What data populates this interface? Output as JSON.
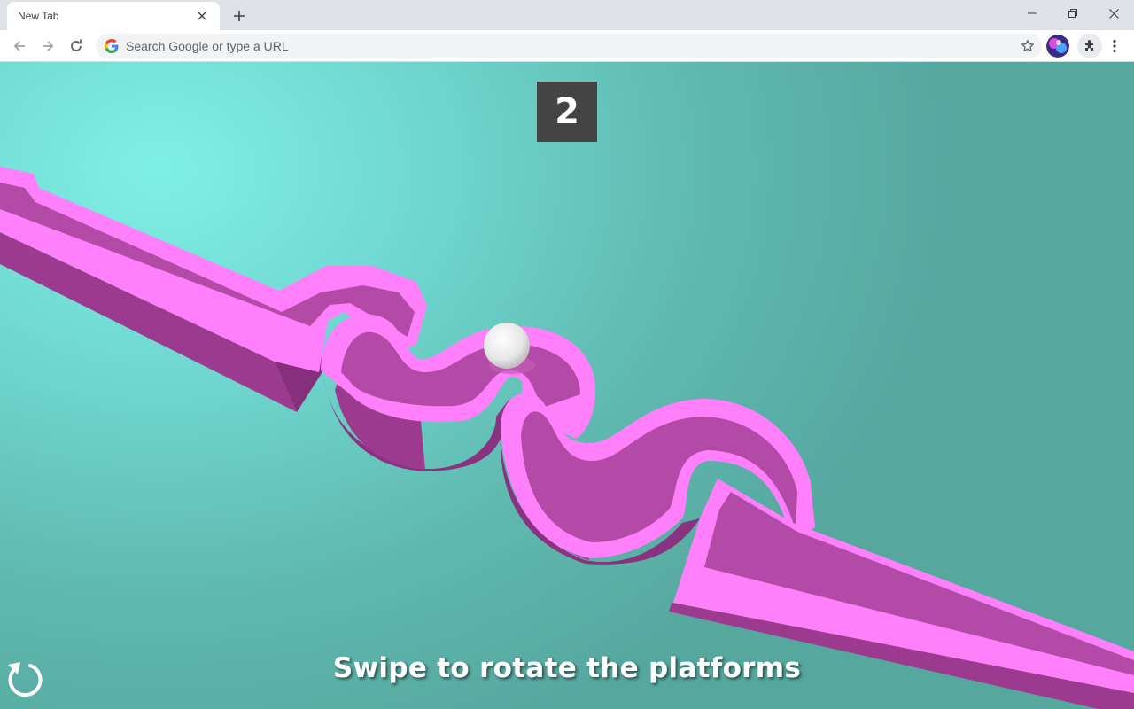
{
  "browser": {
    "tab_title": "New Tab",
    "omnibox_placeholder": "Search Google or type a URL",
    "icons": [
      "close-icon",
      "plus-icon",
      "minimize-icon",
      "restore-icon",
      "window-close-icon",
      "back-arrow-icon",
      "forward-arrow-icon",
      "reload-icon",
      "google-logo-icon",
      "star-icon",
      "avatar",
      "puzzle-icon",
      "kebab-menu-icon"
    ]
  },
  "game": {
    "score": "2",
    "hint": "Swipe to rotate the platforms",
    "restart_icon": "restart-icon",
    "colors": {
      "platform_top": "#ff80fa",
      "platform_side": "#9c3a8f",
      "background": "#6fd6cf",
      "score_bg": "#444444",
      "ball": "#f2f2f2"
    }
  }
}
